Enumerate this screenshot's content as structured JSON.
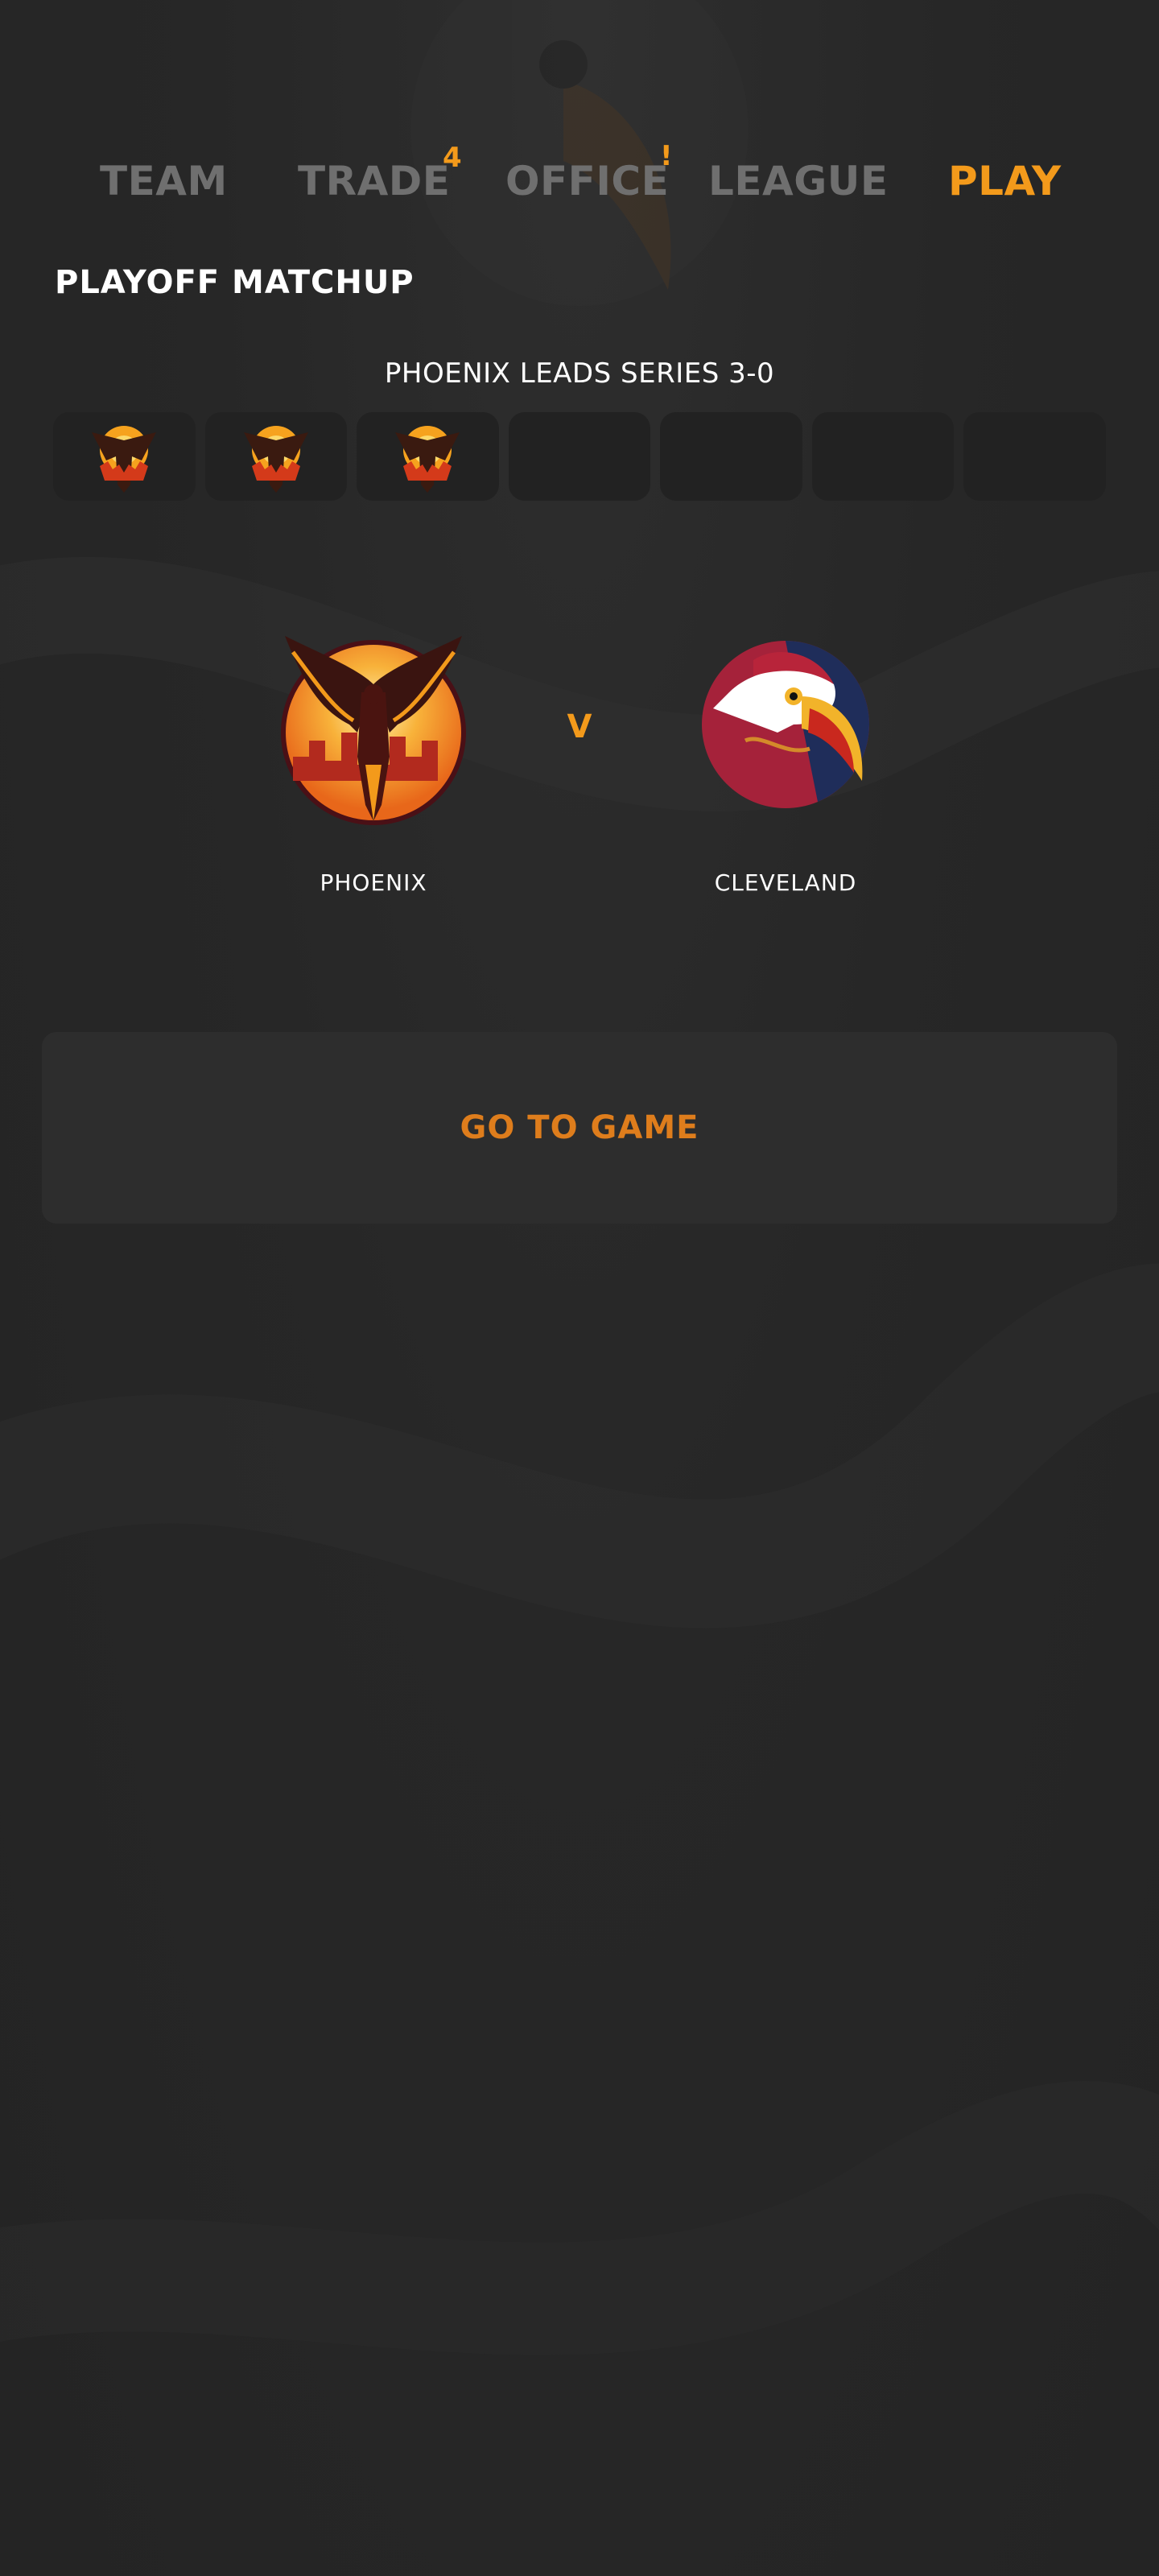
{
  "nav": {
    "items": [
      {
        "label": "TEAM",
        "badge": ""
      },
      {
        "label": "TRADE",
        "badge": "4"
      },
      {
        "label": "OFFICE",
        "badge": "!"
      },
      {
        "label": "LEAGUE",
        "badge": ""
      },
      {
        "label": "PLAY",
        "badge": ""
      }
    ],
    "active": "PLAY"
  },
  "section_title": "PLAYOFF MATCHUP",
  "series": {
    "status": "PHOENIX LEADS SERIES 3-0",
    "games": [
      {
        "winner": "phoenix"
      },
      {
        "winner": "phoenix"
      },
      {
        "winner": "phoenix"
      },
      {
        "winner": ""
      },
      {
        "winner": ""
      },
      {
        "winner": ""
      },
      {
        "winner": ""
      }
    ]
  },
  "matchup": {
    "home": {
      "name": "PHOENIX",
      "logo": "phoenix-logo"
    },
    "away": {
      "name": "CLEVELAND",
      "logo": "cleveland-logo"
    },
    "vs": "V"
  },
  "action": {
    "go_label": "GO TO GAME"
  },
  "colors": {
    "accent": "#f39a1b",
    "inactive_nav": "#6f6f6f",
    "background": "#272727",
    "button_text": "#de7d1c"
  }
}
